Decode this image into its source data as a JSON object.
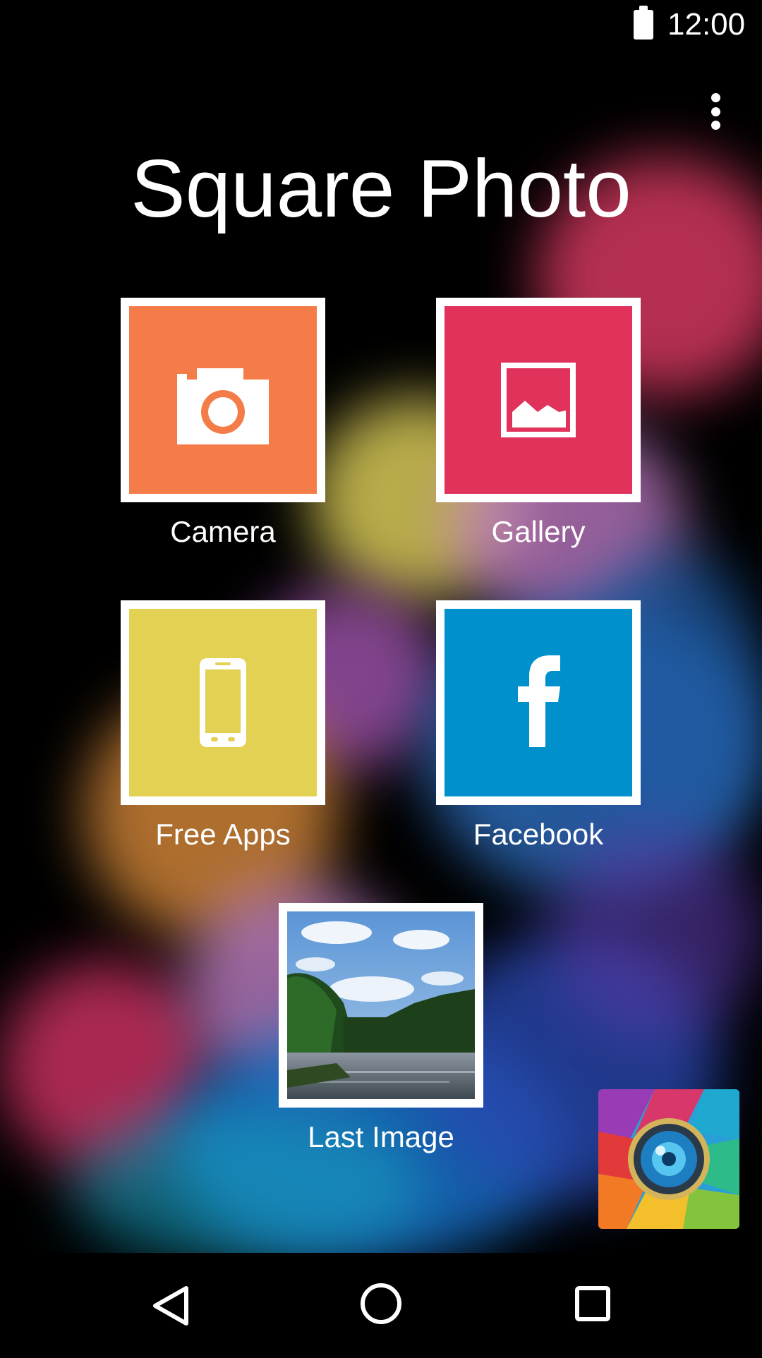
{
  "status_bar": {
    "time": "12:00",
    "battery_icon": "battery-full-icon"
  },
  "header": {
    "title": "Square Photo",
    "menu_icon": "more-vertical-icon"
  },
  "tiles": [
    {
      "label": "Camera",
      "color": "#F47C48",
      "icon": "camera-icon"
    },
    {
      "label": "Gallery",
      "color": "#E0325A",
      "icon": "image-icon"
    },
    {
      "label": "Free Apps",
      "color": "#E2D152",
      "icon": "smartphone-icon"
    },
    {
      "label": "Facebook",
      "color": "#0090CC",
      "icon": "facebook-icon"
    },
    {
      "label": "Last Image",
      "icon": "landscape-photo-thumbnail"
    }
  ],
  "corner_logo": {
    "icon": "camera-lens-logo"
  },
  "nav_bar": {
    "back_icon": "back-triangle-icon",
    "home_icon": "home-circle-icon",
    "recents_icon": "recents-square-icon"
  }
}
